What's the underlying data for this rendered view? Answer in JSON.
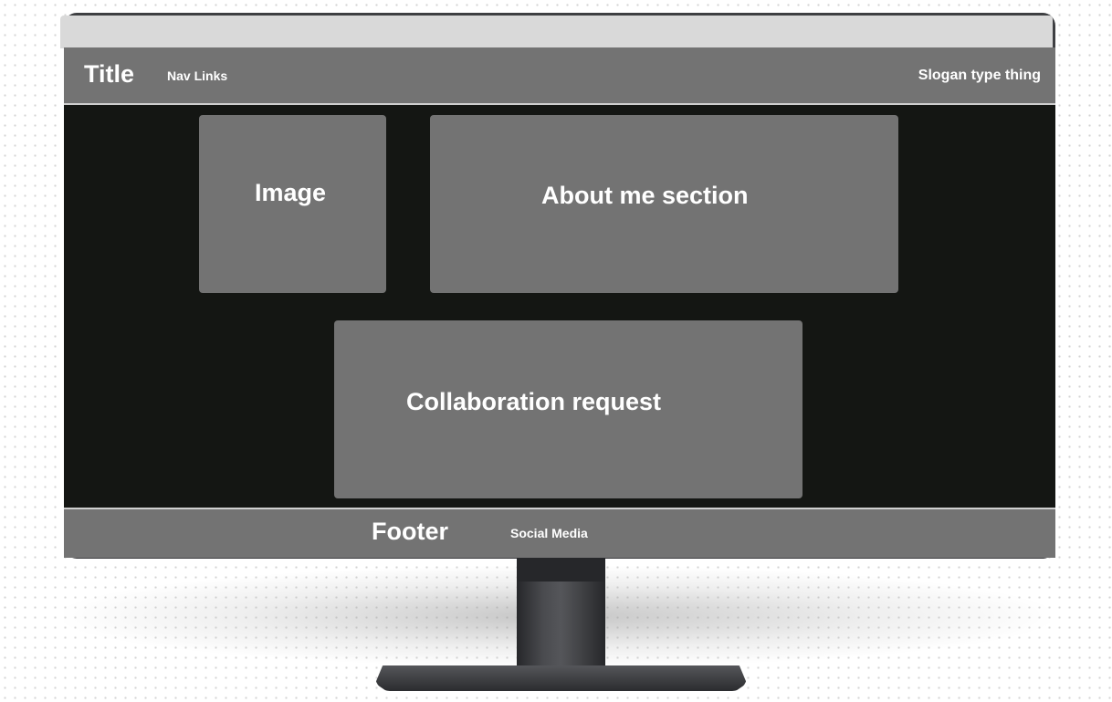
{
  "header": {
    "title": "Title",
    "nav_links": "Nav Links",
    "slogan": "Slogan type thing"
  },
  "main": {
    "image_label": "Image",
    "about_label": "About me section",
    "collab_label": "Collaboration request"
  },
  "footer": {
    "label": "Footer",
    "social": "Social Media"
  },
  "colors": {
    "panel_gray": "#737373",
    "screen_black": "#141613",
    "bezel_light": "#d9d9d9",
    "stand_dark": "#3e3f42"
  }
}
